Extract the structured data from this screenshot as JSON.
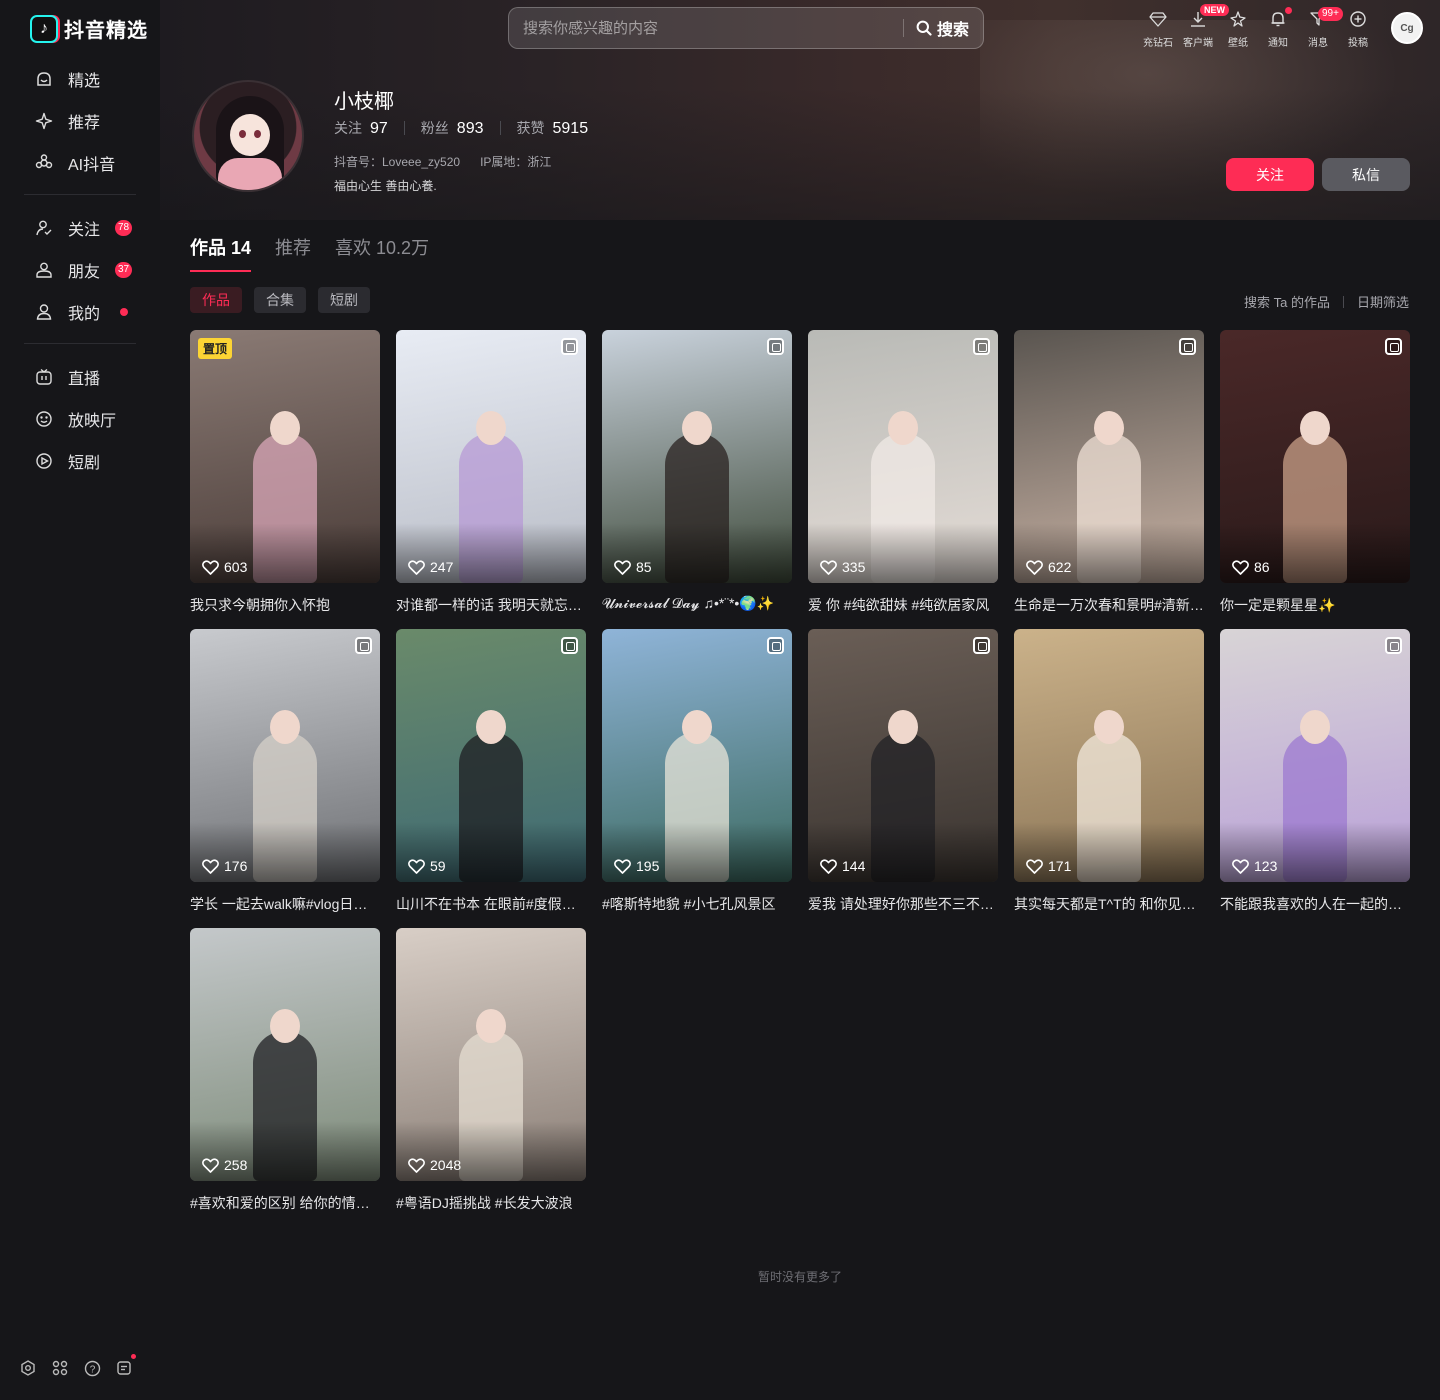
{
  "app": {
    "logo_text": "抖音精选"
  },
  "search": {
    "placeholder": "搜索你感兴趣的内容",
    "button_label": "搜索"
  },
  "toolbar": [
    {
      "icon": "diamond-icon",
      "label": "充钻石"
    },
    {
      "icon": "download-icon",
      "label": "客户端",
      "badge": "NEW"
    },
    {
      "icon": "wallpaper-icon",
      "label": "壁纸"
    },
    {
      "icon": "bell-icon",
      "label": "通知",
      "dot": true
    },
    {
      "icon": "message-icon",
      "label": "消息",
      "badge": "99+"
    },
    {
      "icon": "upload-icon",
      "label": "投稿"
    }
  ],
  "sidebar": {
    "group1": [
      {
        "icon": "featured-icon",
        "label": "精选"
      },
      {
        "icon": "recommend-icon",
        "label": "推荐"
      },
      {
        "icon": "ai-icon",
        "label": "AI抖音"
      }
    ],
    "group2": [
      {
        "icon": "follow-icon",
        "label": "关注",
        "badge": "78"
      },
      {
        "icon": "friends-icon",
        "label": "朋友",
        "badge": "37"
      },
      {
        "icon": "me-icon",
        "label": "我的",
        "dot": true
      }
    ],
    "group3": [
      {
        "icon": "live-icon",
        "label": "直播"
      },
      {
        "icon": "theater-icon",
        "label": "放映厅"
      },
      {
        "icon": "short-drama-icon",
        "label": "短剧"
      }
    ]
  },
  "profile": {
    "name": "小枝椰",
    "stats": [
      {
        "label": "关注",
        "value": "97"
      },
      {
        "label": "粉丝",
        "value": "893"
      },
      {
        "label": "获赞",
        "value": "5915"
      }
    ],
    "douyin_id": "抖音号：Loveee_zy520",
    "ip_location": "IP属地：浙江",
    "bio": "福由心生 善由心養.",
    "follow_label": "关注",
    "message_label": "私信"
  },
  "tabs": [
    {
      "label": "作品 14",
      "active": true
    },
    {
      "label": "推荐",
      "active": false
    },
    {
      "label": "喜欢 10.2万",
      "active": false
    }
  ],
  "filters": [
    {
      "label": "作品",
      "active": true
    },
    {
      "label": "合集",
      "active": false
    },
    {
      "label": "短剧",
      "active": false
    }
  ],
  "right_links": {
    "search_works": "搜索 Ta 的作品",
    "date_filter": "日期筛选"
  },
  "videos": [
    {
      "likes": "603",
      "caption": "我只求今朝拥你入怀抱",
      "pinned": "置顶",
      "colors": [
        "#8a7a74",
        "#4a3c38"
      ],
      "figure": "#d9a7b8"
    },
    {
      "likes": "247",
      "caption": "对谁都一样的话 我明天就忘了你",
      "multi": true,
      "colors": [
        "#e8ecf4",
        "#b8bcc6"
      ],
      "figure": "#b79ad6"
    },
    {
      "likes": "85",
      "caption": "𝓤𝓷𝓲𝓿𝓮𝓻𝓼𝓪𝓵 𝓓𝓪𝔂 ♫•*¨*•🌍✨",
      "multi": true,
      "colors": [
        "#c9d2dc",
        "#3e4a3a"
      ],
      "figure": "#2a2220"
    },
    {
      "likes": "335",
      "caption": "爱 你 #纯欲甜妹 #纯欲居家风",
      "multi": true,
      "colors": [
        "#b9bab6",
        "#e4dcd6"
      ],
      "figure": "#f0eae6"
    },
    {
      "likes": "622",
      "caption": "生命是一万次春和景明#清新花艺",
      "multi": true,
      "colors": [
        "#5a5550",
        "#c8b2a4"
      ],
      "figure": "#efe0d6"
    },
    {
      "likes": "86",
      "caption": "你一定是颗星星✨",
      "multi": true,
      "colors": [
        "#4a2828",
        "#2a1a1a"
      ],
      "figure": "#c9a088"
    },
    {
      "likes": "176",
      "caption": "学长 一起去walk嘛#vlog日常记录",
      "multi": true,
      "colors": [
        "#c8cace",
        "#6e7074"
      ],
      "figure": "#d6d0c8"
    },
    {
      "likes": "59",
      "caption": "山川不在书本 在眼前#度假旅行",
      "multi": true,
      "colors": [
        "#6a8a6a",
        "#3e6a74"
      ],
      "figure": "#1e1e22"
    },
    {
      "likes": "195",
      "caption": "#喀斯特地貌 #小七孔风景区",
      "multi": true,
      "colors": [
        "#8fb4d8",
        "#3c6a60"
      ],
      "figure": "#e8e4d8"
    },
    {
      "likes": "144",
      "caption": "爱我 请处理好你那些不三不四的",
      "multi": true,
      "colors": [
        "#6a5e56",
        "#3a3430"
      ],
      "figure": "#222226"
    },
    {
      "likes": "171",
      "caption": "其实每天都是T^T的 和你见面也是",
      "colors": [
        "#cbb28a",
        "#8a7456"
      ],
      "figure": "#f2e8dc"
    },
    {
      "likes": "123",
      "caption": "不能跟我喜欢的人在一起的日子",
      "multi": true,
      "colors": [
        "#d8d4d6",
        "#b9a0d8"
      ],
      "figure": "#9c7ad0"
    },
    {
      "likes": "258",
      "caption": "#喜欢和爱的区别 给你的情绪价值",
      "colors": [
        "#c4c8ca",
        "#7c8a78"
      ],
      "figure": "#202024"
    },
    {
      "likes": "2048",
      "caption": "#粤语DJ摇挑战 #长发大波浪",
      "colors": [
        "#d8cec6",
        "#8a7e76"
      ],
      "figure": "#e6ddd2"
    }
  ],
  "footer": {
    "no_more": "暂时没有更多了"
  },
  "colors": {
    "accent": "#fe2c55",
    "background": "#161619",
    "pin": "#fcd434"
  }
}
